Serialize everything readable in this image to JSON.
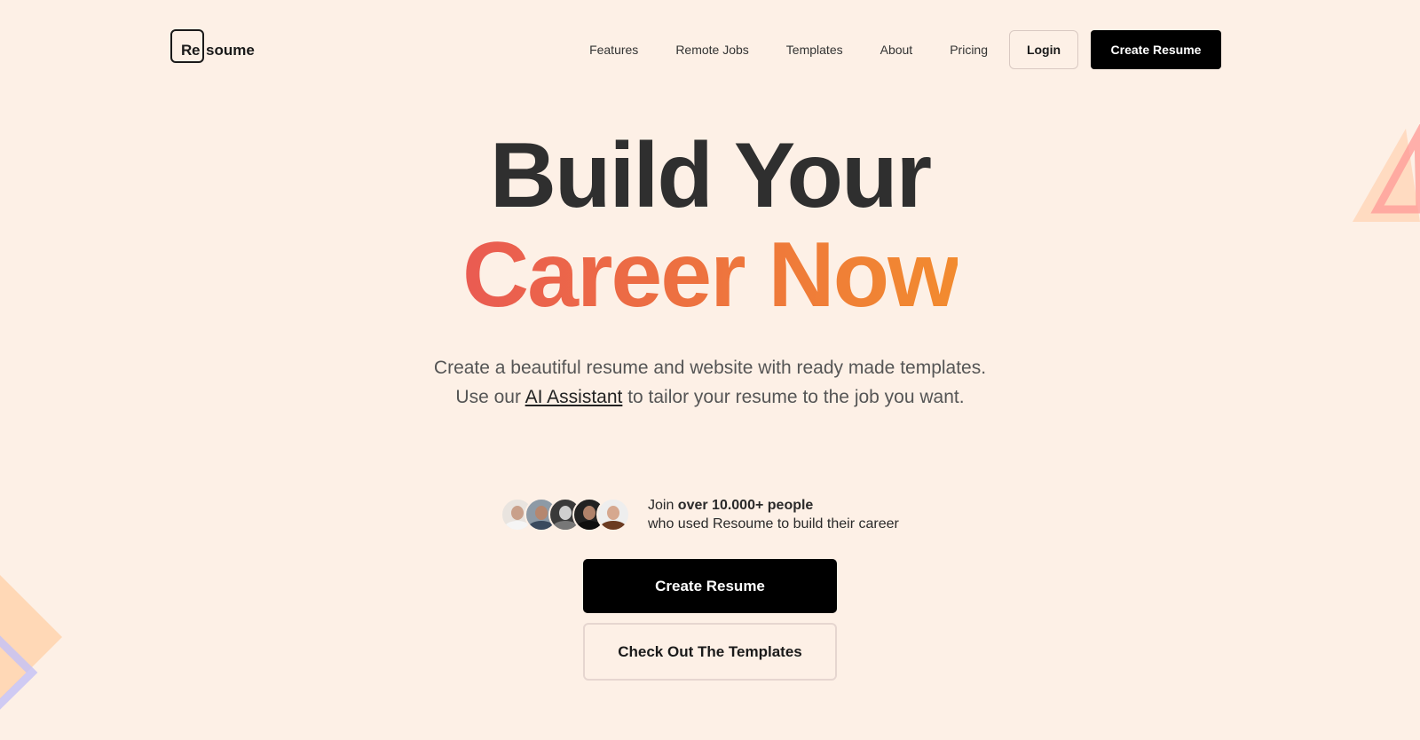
{
  "brand": {
    "logo_box": "Re",
    "logo_rest": "soume"
  },
  "nav": {
    "links": [
      "Features",
      "Remote Jobs",
      "Templates",
      "About",
      "Pricing"
    ],
    "login_label": "Login",
    "create_label": "Create Resume"
  },
  "hero": {
    "line1": "Build Your",
    "line2": "Career Now",
    "subtitle_line1": "Create a beautiful resume and website with ready made templates.",
    "subtitle_pre": "Use our ",
    "subtitle_link": "AI Assistant",
    "subtitle_post": " to tailor your resume to the job you want."
  },
  "proof": {
    "join": "Join ",
    "count": "over 10.000+ people",
    "line2": "who used Resoume to build their career",
    "avatar_count": 5
  },
  "cta": {
    "primary_label": "Create Resume",
    "secondary_label": "Check Out The Templates"
  },
  "colors": {
    "background": "#fdf0e6",
    "primary": "#000000",
    "gradient_start": "#ea5b52",
    "gradient_end": "#f28b2f"
  }
}
